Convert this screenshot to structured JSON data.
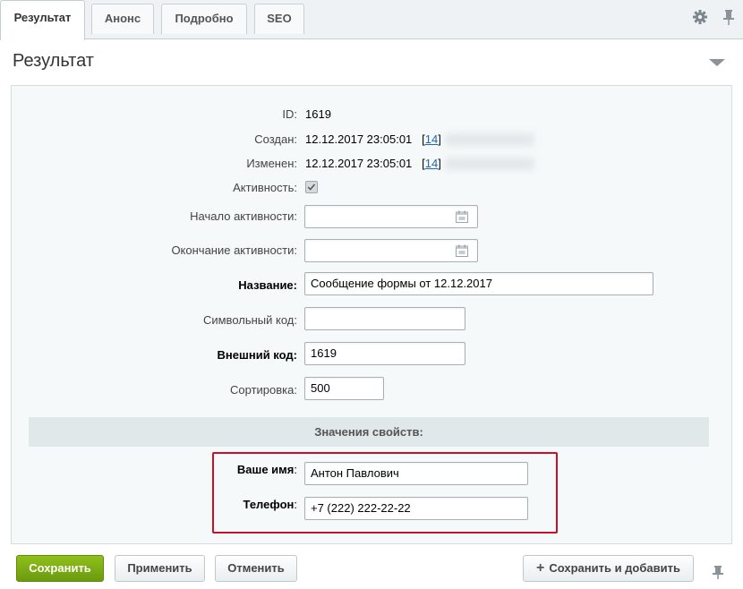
{
  "tabs": [
    {
      "label": "Результат"
    },
    {
      "label": "Анонс"
    },
    {
      "label": "Подробно"
    },
    {
      "label": "SEO"
    }
  ],
  "header_icons": [
    "gear-icon",
    "pin-icon"
  ],
  "section": {
    "title": "Результат"
  },
  "form": {
    "id": {
      "label": "ID:",
      "value": "1619"
    },
    "created": {
      "label": "Создан:",
      "value": "12.12.2017 23:05:01",
      "link_pre": "[",
      "link": "14",
      "link_post": "]"
    },
    "modified": {
      "label": "Изменен:",
      "value": "12.12.2017 23:05:01",
      "link_pre": "[",
      "link": "14",
      "link_post": "]"
    },
    "active": {
      "label": "Активность:",
      "checked": true
    },
    "active_from": {
      "label": "Начало активности:",
      "value": ""
    },
    "active_to": {
      "label": "Окончание активности:",
      "value": ""
    },
    "name": {
      "label": "Название:",
      "value": "Сообщение формы от 12.12.2017"
    },
    "code": {
      "label": "Символьный код:",
      "value": ""
    },
    "xml_id": {
      "label": "Внешний код:",
      "value": "1619"
    },
    "sort": {
      "label": "Сортировка:",
      "value": "500"
    }
  },
  "properties": {
    "title": "Значения свойств:",
    "name": {
      "label": "Ваше имя",
      "suffix": ":",
      "value": "Антон Павлович"
    },
    "phone": {
      "label": "Телефон",
      "suffix": ":",
      "value": "+7 (222) 222-22-22"
    }
  },
  "footer": {
    "save": "Сохранить",
    "apply": "Применить",
    "cancel": "Отменить",
    "save_add": "Сохранить и добавить"
  },
  "colors": {
    "save_button": "#7aab13",
    "highlight_border": "#c8102e",
    "link": "#2067b0"
  }
}
